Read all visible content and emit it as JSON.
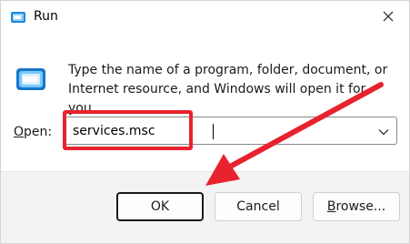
{
  "window": {
    "title": "Run",
    "app_icon": "run-icon",
    "close_icon": "close-icon"
  },
  "body": {
    "icon": "run-program-icon",
    "description": "Type the name of a program, folder, document, or Internet resource, and Windows will open it for you."
  },
  "open_field": {
    "label_accel": "O",
    "label_rest": "pen:",
    "value": "services.msc",
    "dropdown_icon": "chevron-down-icon"
  },
  "buttons": {
    "ok": "OK",
    "cancel": "Cancel",
    "browse_accel": "B",
    "browse_rest": "rowse..."
  },
  "annotation": {
    "highlight_color": "#e8222e",
    "arrow_color": "#e8222e"
  }
}
